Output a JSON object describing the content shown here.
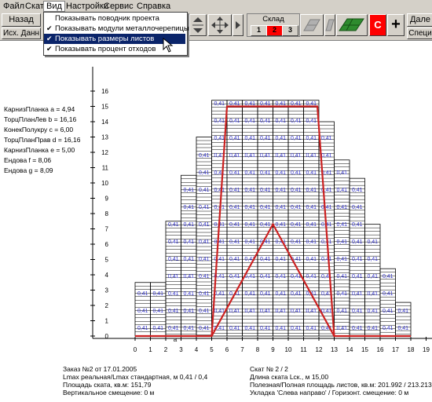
{
  "menu": {
    "file": "Файл",
    "slope": "Скат",
    "view": "Вид",
    "settings": "Настройки",
    "service": "Сервис",
    "help": "Справка"
  },
  "toolbar": {
    "back": "Назад",
    "source_data": "Исх. Данн",
    "warehouse_title": "Склад листами",
    "sheet1": "1",
    "sheet2": "2",
    "sheet3": "3",
    "c_label": "С",
    "plus_label": "+",
    "next": "Дале",
    "special": "Специ"
  },
  "view_menu": [
    {
      "label": "Показывать поводник проекта",
      "checked": false
    },
    {
      "label": "Показывать модули металлочерепицы",
      "checked": true
    },
    {
      "label": "Показывать размеры листов",
      "checked": true,
      "selected": true
    },
    {
      "label": "Показывать процент отходов",
      "checked": true
    }
  ],
  "params": [
    "КарнизПланка а = 4,94",
    "ТорцПланЛев b = 16,16",
    "КонекПолукру с = 6,00",
    "ТорцПланПрав d = 16,16",
    "КарнизПланка е = 5,00",
    "Ендова f = 8,06",
    "Ендова g = 8,09"
  ],
  "bottom": {
    "order": "Заказ №2 от 17.01.2005",
    "lmax": "Lmax реальная/Lmax стандартная, м 0,41 / 0,4",
    "area": "Площадь ската, кв.м: 151,79",
    "vshift": "Вертикальное смещение:  0  м",
    "slope_no": "Скат № 2 / 2",
    "slope_len": "Длина ската Lск., м 15,00",
    "useful_area": "Полезная/Полная площадь листов, кв.м: 201.992 / 213.213",
    "layout": "Укладка 'Слева направо' / Горизонт. смещение: 0 м"
  },
  "chart_data": {
    "type": "diagram",
    "x_ticks": [
      "0",
      "1",
      "2",
      "3",
      "4",
      "5",
      "6",
      "7",
      "8",
      "9",
      "10",
      "11",
      "12",
      "13",
      "14",
      "15",
      "16",
      "17",
      "18",
      "19"
    ],
    "y_ticks": [
      "0",
      "1",
      "2",
      "3",
      "4",
      "5",
      "6",
      "7",
      "8",
      "9",
      "10",
      "11",
      "12",
      "13",
      "14",
      "15",
      "16"
    ],
    "sheet_label": "0,41",
    "point_label": "a",
    "roof_outline": [
      [
        0,
        0
      ],
      [
        5,
        0
      ],
      [
        6,
        15
      ],
      [
        11.9,
        15
      ],
      [
        13,
        0
      ],
      [
        18,
        0
      ]
    ],
    "valley_outline": [
      [
        5,
        0
      ],
      [
        9,
        7.3
      ],
      [
        13,
        0
      ]
    ],
    "columns": [
      {
        "x0": 0,
        "x1": 1,
        "top": 3.5
      },
      {
        "x0": 1,
        "x1": 2,
        "top": 3.5
      },
      {
        "x0": 2,
        "x1": 3,
        "top": 7.5
      },
      {
        "x0": 3,
        "x1": 4,
        "top": 10.5
      },
      {
        "x0": 4,
        "x1": 5,
        "top": 13
      },
      {
        "x0": 5,
        "x1": 6,
        "top": 15.4
      },
      {
        "x0": 6,
        "x1": 7,
        "top": 15.4
      },
      {
        "x0": 7,
        "x1": 8,
        "top": 15.4
      },
      {
        "x0": 8,
        "x1": 9,
        "top": 15.4
      },
      {
        "x0": 9,
        "x1": 10,
        "top": 15.4
      },
      {
        "x0": 10,
        "x1": 11,
        "top": 15.4
      },
      {
        "x0": 11,
        "x1": 12,
        "top": 15.4
      },
      {
        "x0": 12,
        "x1": 13,
        "top": 14
      },
      {
        "x0": 13,
        "x1": 14,
        "top": 11.5
      },
      {
        "x0": 14,
        "x1": 15,
        "top": 10.3
      },
      {
        "x0": 15,
        "x1": 16,
        "top": 7.3
      },
      {
        "x0": 16,
        "x1": 17,
        "top": 4.4
      },
      {
        "x0": 17,
        "x1": 18,
        "top": 2.2
      }
    ]
  },
  "colors": {
    "window_bg": "#d4d0c8",
    "selection": "#0a246a",
    "roof_line": "#cc2020",
    "sheet_text": "#3333cc",
    "red_button": "#ff0000"
  }
}
